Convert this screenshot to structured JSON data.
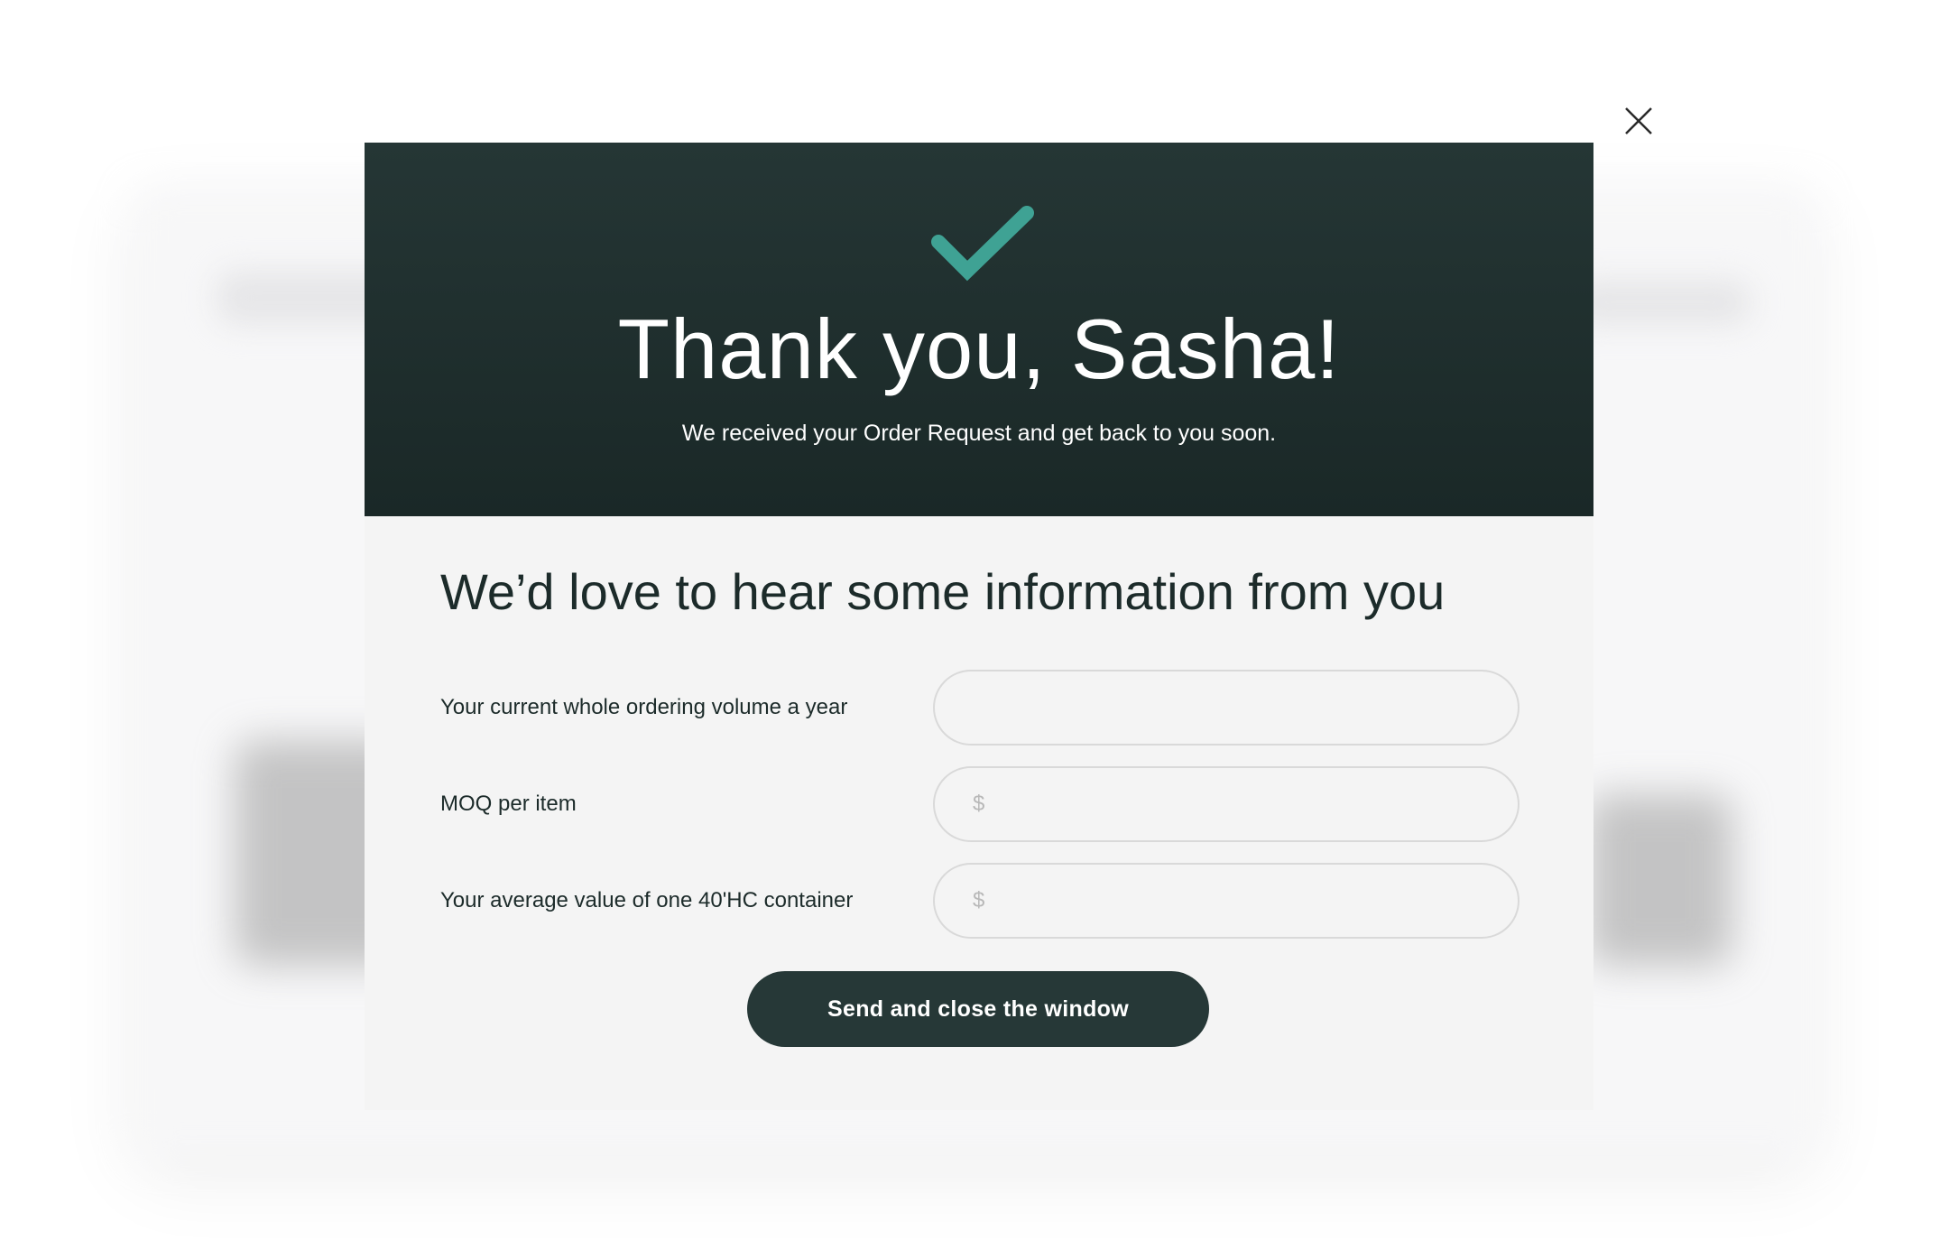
{
  "colors": {
    "header_bg": "#1f2f2e",
    "accent_check": "#3fa294",
    "button_bg": "#263837",
    "modal_bg": "#f4f4f4",
    "text_dark": "#1c2b2a"
  },
  "close": {
    "icon": "close-icon"
  },
  "header": {
    "icon": "checkmark-icon",
    "title": "Thank you, Sasha!",
    "subtitle": "We received your Order Request and get back to you soon."
  },
  "form": {
    "title": "We’d love to hear some information from you",
    "fields": [
      {
        "label": "Your current whole ordering volume a year",
        "value": "",
        "placeholder": ""
      },
      {
        "label": "MOQ per item",
        "value": "",
        "placeholder": "$"
      },
      {
        "label": "Your average value of one 40'HC container",
        "value": "",
        "placeholder": "$"
      }
    ],
    "submit_label": "Send and close the window"
  }
}
